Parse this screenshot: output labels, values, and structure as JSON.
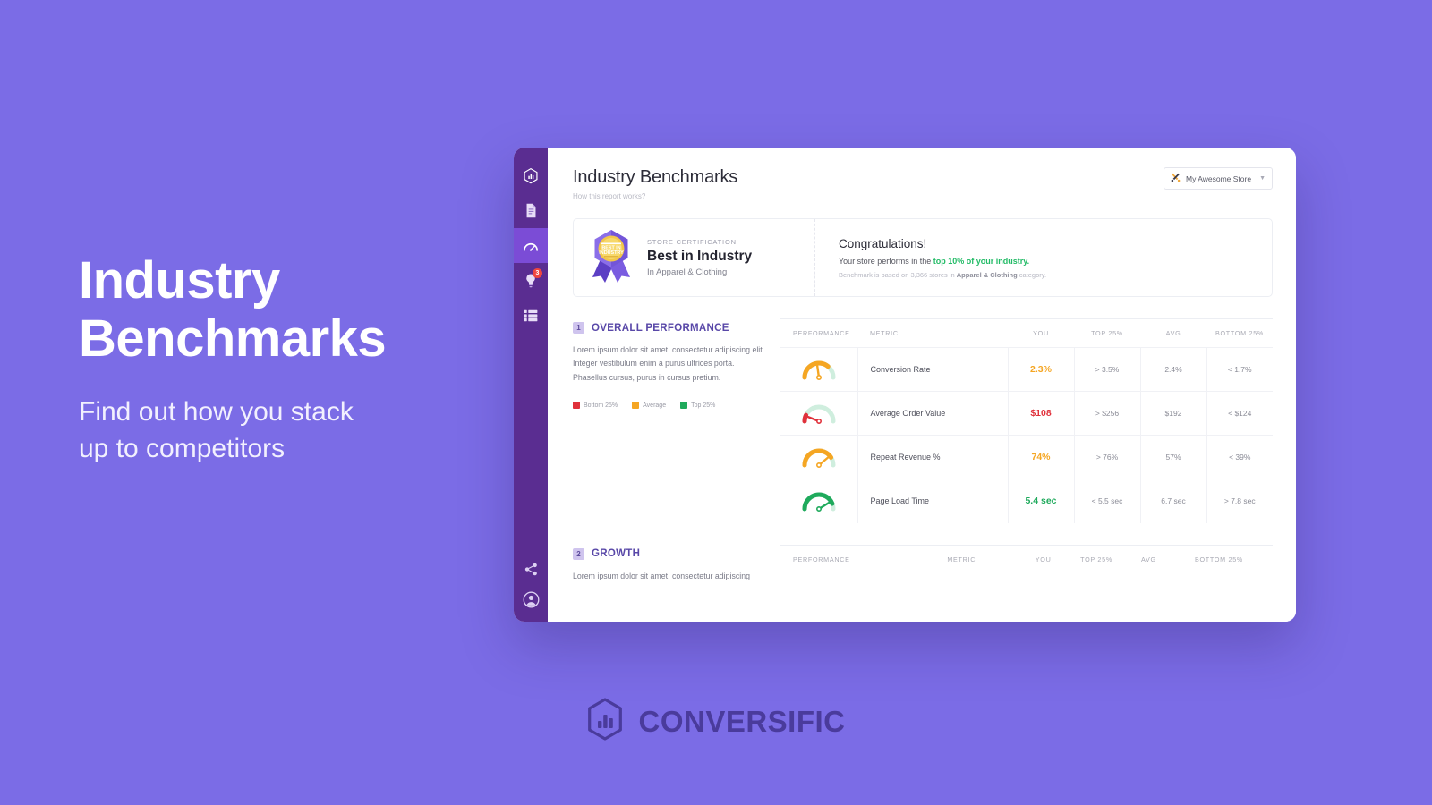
{
  "hero": {
    "title_line1": "Industry",
    "title_line2": "Benchmarks",
    "subtitle_line1": "Find out how you stack",
    "subtitle_line2": "up to competitors"
  },
  "brand": {
    "wordmark": "CONVERSIFIC",
    "logo_icon": "hexagon-bar-chart-icon",
    "accent": "#7b6ce6",
    "logo_color": "#4a3b9c"
  },
  "sidebar": {
    "background": "#5a2d91",
    "active_background": "#7b4cd6",
    "items": [
      {
        "icon": "hexagon-logo-icon",
        "name": "app-logo",
        "active": false,
        "badge": null
      },
      {
        "icon": "document-icon",
        "name": "reports",
        "active": false,
        "badge": null
      },
      {
        "icon": "gauge-icon",
        "name": "benchmarks",
        "active": true,
        "badge": null
      },
      {
        "icon": "lightbulb-icon",
        "name": "insights",
        "active": false,
        "badge": "3"
      },
      {
        "icon": "list-icon",
        "name": "tasks",
        "active": false,
        "badge": null
      }
    ],
    "bottom_items": [
      {
        "icon": "share-icon",
        "name": "share"
      },
      {
        "icon": "user-avatar-icon",
        "name": "account"
      }
    ]
  },
  "header": {
    "title": "Industry Benchmarks",
    "subtitle": "How this report works?",
    "store_selector": {
      "icon": "tools-icon",
      "value": "My Awesome Store",
      "chevron": "chevron-down-icon"
    }
  },
  "certification": {
    "badge_icon": "best-in-industry-medal",
    "badge_line1": "BEST IN",
    "badge_line2": "INDUSTRY",
    "eyebrow": "STORE CERTIFICATION",
    "title": "Best in Industry",
    "category": "In Apparel & Clothing",
    "congrats_title": "Congratulations!",
    "congrats_text_prefix": "Your store performs in the ",
    "congrats_highlight": "top 10% of your industry.",
    "note_prefix": "Benchmark is based on 3,366 stores in ",
    "note_bold": "Apparel & Clothing",
    "note_suffix": " category."
  },
  "legend": [
    {
      "label": "Bottom 25%",
      "color": "#e0313b"
    },
    {
      "label": "Average",
      "color": "#f5a623"
    },
    {
      "label": "Top 25%",
      "color": "#1faa5c"
    }
  ],
  "table_headers": [
    "PERFORMANCE",
    "METRIC",
    "YOU",
    "TOP 25%",
    "AVG",
    "BOTTOM 25%"
  ],
  "sections": [
    {
      "number": "1",
      "title": "OVERALL PERFORMANCE",
      "body": "Lorem ipsum dolor sit amet, consectetur adipiscing elit. Integer vestibulum enim a purus ultrices porta. Phasellus cursus, purus in cursus pretium.",
      "rows": [
        {
          "metric": "Conversion Rate",
          "you": "2.3%",
          "you_state": "orange",
          "top25": "> 3.5%",
          "avg": "2.4%",
          "bottom25": "< 1.7%",
          "gauge": {
            "color": "#f5a623",
            "fill": 0.72,
            "needle": 82
          }
        },
        {
          "metric": "Average Order Value",
          "you": "$108",
          "you_state": "red",
          "top25": "> $256",
          "avg": "$192",
          "bottom25": "< $124",
          "gauge": {
            "color": "#e0313b",
            "fill": 0.14,
            "needle": 22
          }
        },
        {
          "metric": "Repeat Revenue %",
          "you": "74%",
          "you_state": "orange",
          "top25": "> 76%",
          "avg": "57%",
          "bottom25": "< 39%",
          "gauge": {
            "color": "#f5a623",
            "fill": 0.82,
            "needle": 140
          }
        },
        {
          "metric": "Page Load Time",
          "you": "5.4 sec",
          "you_state": "green",
          "top25": "< 5.5 sec",
          "avg": "6.7 sec",
          "bottom25": "> 7.8 sec",
          "gauge": {
            "color": "#1faa5c",
            "fill": 0.88,
            "needle": 148
          }
        }
      ]
    },
    {
      "number": "2",
      "title": "GROWTH",
      "body": "Lorem ipsum dolor sit amet, consectetur adipiscing",
      "rows": []
    }
  ]
}
